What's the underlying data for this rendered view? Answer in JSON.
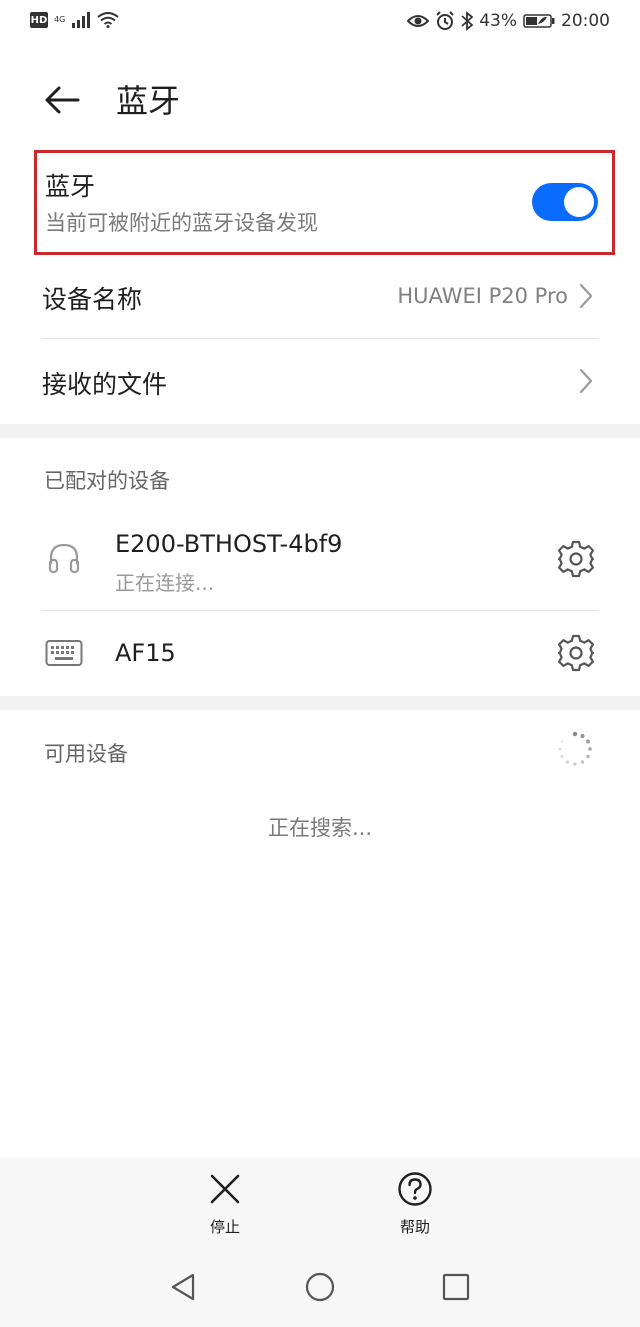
{
  "status_bar": {
    "hd": "HD",
    "network": "4G",
    "battery": "43%",
    "time": "20:00"
  },
  "header": {
    "title": "蓝牙"
  },
  "bluetooth": {
    "title": "蓝牙",
    "subtitle": "当前可被附近的蓝牙设备发现",
    "enabled": true,
    "accent": "#0a6cff"
  },
  "settings": {
    "device_name_label": "设备名称",
    "device_name_value": "HUAWEI P20 Pro",
    "received_files_label": "接收的文件"
  },
  "paired": {
    "section_title": "已配对的设备",
    "devices": [
      {
        "name": "E200-BTHOST-4bf9",
        "status": "正在连接...",
        "icon": "headset-icon"
      },
      {
        "name": "AF15",
        "status": "",
        "icon": "keyboard-icon"
      }
    ]
  },
  "available": {
    "section_title": "可用设备",
    "searching_text": "正在搜索..."
  },
  "actions": {
    "stop_label": "停止",
    "help_label": "帮助"
  }
}
